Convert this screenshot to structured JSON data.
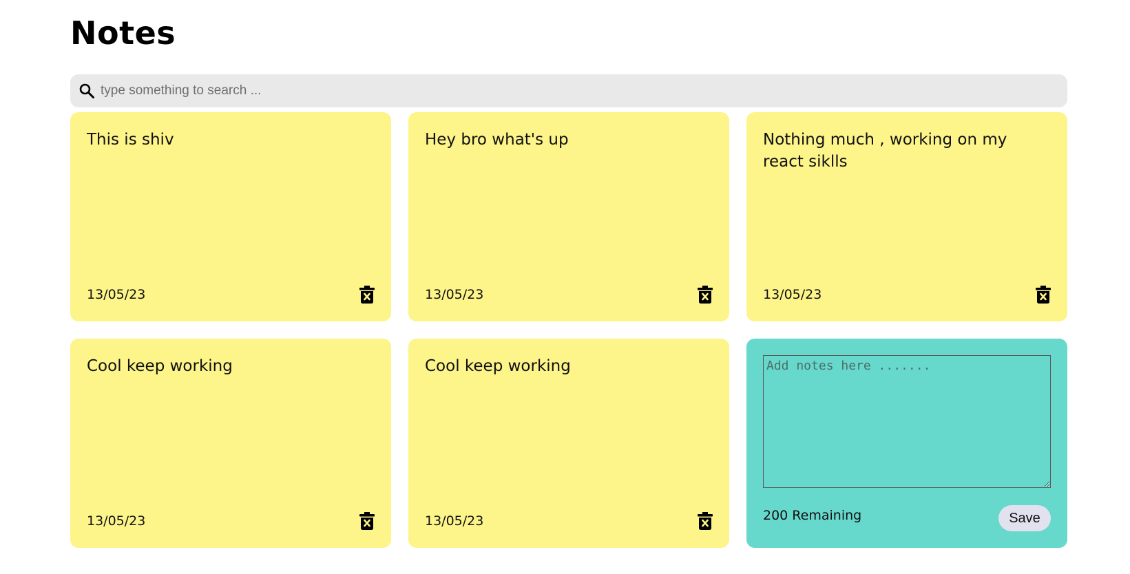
{
  "header": {
    "title": "Notes"
  },
  "search": {
    "placeholder": "type something to search ...",
    "value": "",
    "icon": "search-icon"
  },
  "notes": [
    {
      "text": "This is shiv",
      "date": "13/05/23",
      "delete_icon": "delete-icon"
    },
    {
      "text": "Hey bro what's up",
      "date": "13/05/23",
      "delete_icon": "delete-icon"
    },
    {
      "text": "Nothing much , working on my react siklls",
      "date": "13/05/23",
      "delete_icon": "delete-icon"
    },
    {
      "text": "Cool keep working",
      "date": "13/05/23",
      "delete_icon": "delete-icon"
    },
    {
      "text": "Cool keep working",
      "date": "13/05/23",
      "delete_icon": "delete-icon"
    }
  ],
  "new_note": {
    "placeholder": "Add notes here .......",
    "value": "",
    "remaining": "200 Remaining",
    "save_label": "Save"
  },
  "colors": {
    "note_background": "#fdf48a",
    "new_note_background": "#67d8cc",
    "search_background": "#e9e9e9",
    "save_button_background": "#e2e2ef"
  }
}
